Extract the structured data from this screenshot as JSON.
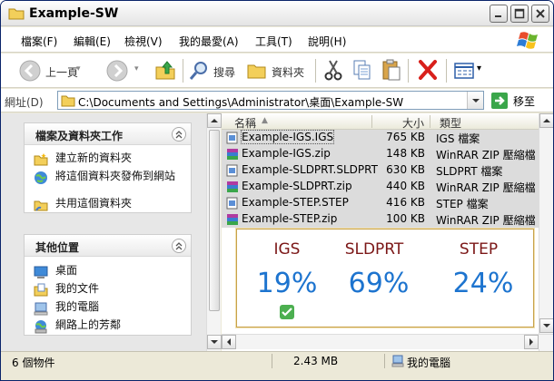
{
  "window": {
    "title": "Example-SW"
  },
  "menu": [
    "檔案(F)",
    "編輯(E)",
    "檢視(V)",
    "我的最愛(A)",
    "工具(T)",
    "說明(H)"
  ],
  "toolbar": {
    "back": "上一頁",
    "search": "搜尋",
    "folders": "資料夾"
  },
  "address": {
    "label": "網址(D)",
    "path": "C:\\Documents and Settings\\Administrator\\桌面\\Example-SW",
    "go": "移至"
  },
  "tasks_panel": {
    "title": "檔案及資料夾工作",
    "items": [
      "建立新的資料夾",
      "將這個資料夾發佈到網站",
      "共用這個資料夾"
    ]
  },
  "places_panel": {
    "title": "其他位置",
    "items": [
      "桌面",
      "我的文件",
      "我的電腦",
      "網路上的芳鄰"
    ]
  },
  "columns": {
    "name": "名稱",
    "size": "大小",
    "type": "類型"
  },
  "files": [
    {
      "name": "Example-IGS.IGS",
      "size": "765 KB",
      "type": "IGS 檔案",
      "icon": "igs-file-icon"
    },
    {
      "name": "Example-IGS.zip",
      "size": "148 KB",
      "type": "WinRAR ZIP 壓縮檔",
      "icon": "zip-icon"
    },
    {
      "name": "Example-SLDPRT.SLDPRT",
      "size": "630 KB",
      "type": "SLDPRT 檔案",
      "icon": "sldprt-file-icon"
    },
    {
      "name": "Example-SLDPRT.zip",
      "size": "440 KB",
      "type": "WinRAR ZIP 壓縮檔",
      "icon": "zip-icon"
    },
    {
      "name": "Example-STEP.STEP",
      "size": "416 KB",
      "type": "STEP 檔案",
      "icon": "step-file-icon"
    },
    {
      "name": "Example-STEP.zip",
      "size": "100 KB",
      "type": "WinRAR ZIP 壓縮檔",
      "icon": "zip-icon"
    }
  ],
  "compression": [
    {
      "format": "IGS",
      "percent": "19%",
      "checked": true
    },
    {
      "format": "SLDPRT",
      "percent": "69%",
      "checked": false
    },
    {
      "format": "STEP",
      "percent": "24%",
      "checked": false
    }
  ],
  "status": {
    "objects": "6 個物件",
    "size": "2.43 MB",
    "location": "我的電腦"
  },
  "colors": {
    "format_label": "#7b1616",
    "percent": "#1d74cf",
    "card_border": "#c8a24a"
  }
}
